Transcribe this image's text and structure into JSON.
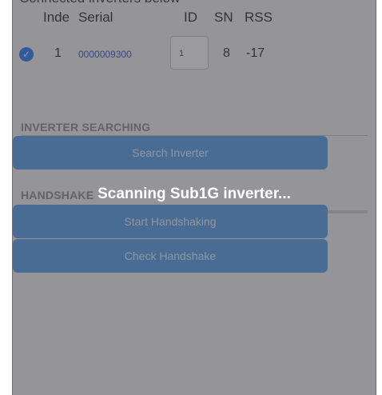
{
  "table": {
    "partial_heading": "Connected inverters below",
    "headers": {
      "index": "Inde",
      "serial": "Serial",
      "id": "ID",
      "sn": "SN",
      "rss": "RSS"
    },
    "rows": [
      {
        "selected": true,
        "index": "1",
        "serial": "0000009300",
        "id": "1",
        "sn": "8",
        "rss": "-17"
      }
    ]
  },
  "sections": {
    "inverter_searching": {
      "title": "INVERTER SEARCHING",
      "button_label": "Search Inverter"
    },
    "handshake": {
      "title": "HANDSHAKE",
      "button1_label": "Start Handshaking",
      "button2_label": "Check Handshake"
    }
  },
  "progress": {
    "value": 0.31,
    "color": "#2f7df6"
  },
  "overlay": {
    "message": "Scanning Sub1G inverter..."
  },
  "colors": {
    "accent": "#2f7df6",
    "button": "#5aa0ee",
    "background": "#f2f2f7"
  }
}
